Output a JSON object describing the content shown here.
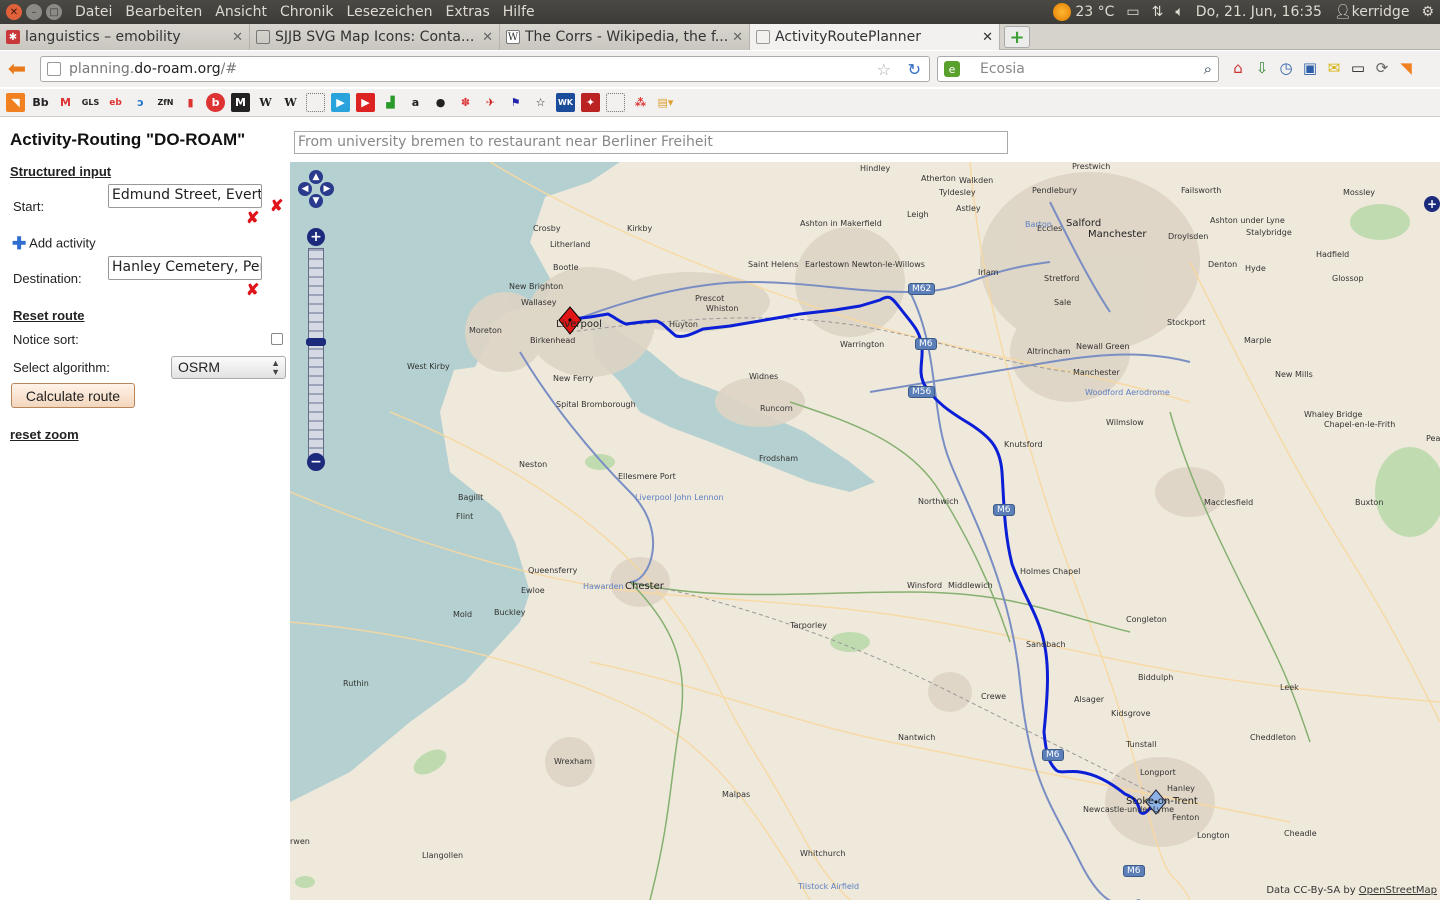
{
  "os": {
    "menu": [
      "Datei",
      "Bearbeiten",
      "Ansicht",
      "Chronik",
      "Lesezeichen",
      "Extras",
      "Hilfe"
    ],
    "weather": "23 °C",
    "datetime": "Do, 21. Jun, 16:35",
    "user": "kerridge"
  },
  "tabs": [
    {
      "title": "languistics – emobility",
      "icon": "puzzle-icon"
    },
    {
      "title": "SJJB SVG Map Icons: Conta...",
      "icon": "page-icon"
    },
    {
      "title": "The Corrs - Wikipedia, the f...",
      "icon": "wikipedia-icon"
    },
    {
      "title": "ActivityRoutePlanner",
      "icon": "page-icon"
    }
  ],
  "nav": {
    "url_prefix": "planning.",
    "url_domain": "do-roam.org",
    "url_suffix": "/#",
    "search_placeholder": "Ecosia"
  },
  "bookmarks": [
    "rss",
    "Bb",
    "gmail",
    "GLS",
    "ebay",
    "spiral",
    "ZfN",
    "bahn",
    "b",
    "M",
    "W",
    "W",
    "blank",
    "play",
    "youtube",
    "stats",
    "amazon",
    "rec",
    "paw",
    "plane",
    "flag",
    "star",
    "WK",
    "puma",
    "blank2",
    "dots",
    "folder"
  ],
  "sidebar": {
    "title": "Activity-Routing \"DO-ROAM\"",
    "structured_input": "Structured input",
    "start_label": "Start:",
    "start_value": "Edmund Street, Everton",
    "add_activity": "Add activity",
    "destination_label": "Destination:",
    "destination_value": "Hanley Cemetery, Penkhull",
    "reset_route": "Reset route",
    "notice_sort": "Notice sort:",
    "select_algorithm": "Select algorithm:",
    "algorithm": "OSRM",
    "calculate": "Calculate route",
    "reset_zoom": "reset zoom"
  },
  "query_placeholder": "From university bremen to restaurant near Berliner Freiheit",
  "map": {
    "attribution_prefix": "Data CC-By-SA by ",
    "attribution_link": "OpenStreetMap",
    "route_color": "#0b1fd6",
    "places": [
      {
        "n": "Hindley",
        "c": ""
      },
      {
        "n": "Atherton",
        "c": ""
      },
      {
        "n": "Walkden",
        "c": ""
      },
      {
        "n": "Prestwich",
        "c": ""
      },
      {
        "n": "Pendlebury",
        "c": ""
      },
      {
        "n": "Failsworth",
        "c": ""
      },
      {
        "n": "Mossley",
        "c": ""
      },
      {
        "n": "Tyldesley",
        "c": ""
      },
      {
        "n": "Astley",
        "c": ""
      },
      {
        "n": "Leigh",
        "c": ""
      },
      {
        "n": "Salford",
        "c": "mid"
      },
      {
        "n": "Manchester",
        "c": "mid"
      },
      {
        "n": "Eccles",
        "c": ""
      },
      {
        "n": "Ashton under Lyne",
        "c": ""
      },
      {
        "n": "Stalybridge",
        "c": ""
      },
      {
        "n": "Droylsden",
        "c": ""
      },
      {
        "n": "Crosby",
        "c": ""
      },
      {
        "n": "Kirkby",
        "c": ""
      },
      {
        "n": "Ashton in Makerfield",
        "c": ""
      },
      {
        "n": "Litherland",
        "c": ""
      },
      {
        "n": "Bootle",
        "c": ""
      },
      {
        "n": "Saint Helens",
        "c": ""
      },
      {
        "n": "Earlestown Newton-le-Willows",
        "c": ""
      },
      {
        "n": "Irlam",
        "c": ""
      },
      {
        "n": "Stretford",
        "c": ""
      },
      {
        "n": "Denton",
        "c": ""
      },
      {
        "n": "Hyde",
        "c": ""
      },
      {
        "n": "Hadfield",
        "c": ""
      },
      {
        "n": "Glossop",
        "c": ""
      },
      {
        "n": "New Brighton",
        "c": ""
      },
      {
        "n": "Wallasey",
        "c": ""
      },
      {
        "n": "Prescot",
        "c": ""
      },
      {
        "n": "Whiston",
        "c": ""
      },
      {
        "n": "Sale",
        "c": ""
      },
      {
        "n": "Stockport",
        "c": ""
      },
      {
        "n": "Moreton",
        "c": ""
      },
      {
        "n": "Liverpool",
        "c": "mid"
      },
      {
        "n": "Huyton",
        "c": ""
      },
      {
        "n": "Birkenhead",
        "c": ""
      },
      {
        "n": "Warrington",
        "c": ""
      },
      {
        "n": "Altrincham",
        "c": ""
      },
      {
        "n": "Newall Green",
        "c": ""
      },
      {
        "n": "Marple",
        "c": ""
      },
      {
        "n": "West Kirby",
        "c": ""
      },
      {
        "n": "New Ferry",
        "c": ""
      },
      {
        "n": "Widnes",
        "c": ""
      },
      {
        "n": "New Mills",
        "c": ""
      },
      {
        "n": "Spital Bromborough",
        "c": ""
      },
      {
        "n": "Runcorn",
        "c": ""
      },
      {
        "n": "Wilmslow",
        "c": ""
      },
      {
        "n": "Whaley Bridge",
        "c": ""
      },
      {
        "n": "Chapel-en-le-Frith",
        "c": ""
      },
      {
        "n": "Knutsford",
        "c": ""
      },
      {
        "n": "Frodsham",
        "c": ""
      },
      {
        "n": "Neston",
        "c": ""
      },
      {
        "n": "Ellesmere Port",
        "c": ""
      },
      {
        "n": "Bagillt",
        "c": ""
      },
      {
        "n": "Northwich",
        "c": ""
      },
      {
        "n": "Macclesfield",
        "c": ""
      },
      {
        "n": "Buxton",
        "c": ""
      },
      {
        "n": "Flint",
        "c": ""
      },
      {
        "n": "Queensferry",
        "c": ""
      },
      {
        "n": "Holmes Chapel",
        "c": ""
      },
      {
        "n": "Ewloe",
        "c": ""
      },
      {
        "n": "Chester",
        "c": "mid"
      },
      {
        "n": "Winsford",
        "c": ""
      },
      {
        "n": "Middlewich",
        "c": ""
      },
      {
        "n": "Mold",
        "c": ""
      },
      {
        "n": "Buckley",
        "c": ""
      },
      {
        "n": "Congleton",
        "c": ""
      },
      {
        "n": "Tarporley",
        "c": ""
      },
      {
        "n": "Sandbach",
        "c": ""
      },
      {
        "n": "Biddulph",
        "c": ""
      },
      {
        "n": "Ruthin",
        "c": ""
      },
      {
        "n": "Leek",
        "c": ""
      },
      {
        "n": "Crewe",
        "c": ""
      },
      {
        "n": "Alsager",
        "c": ""
      },
      {
        "n": "Kidsgrove",
        "c": ""
      },
      {
        "n": "Nantwich",
        "c": ""
      },
      {
        "n": "Tunstall",
        "c": ""
      },
      {
        "n": "Cheddleton",
        "c": ""
      },
      {
        "n": "Wrexham",
        "c": ""
      },
      {
        "n": "Longport",
        "c": ""
      },
      {
        "n": "Hanley",
        "c": ""
      },
      {
        "n": "Malpas",
        "c": ""
      },
      {
        "n": "Stoke-on-Trent",
        "c": "mid"
      },
      {
        "n": "Newcastle-under-Lyme",
        "c": ""
      },
      {
        "n": "Fenton",
        "c": ""
      },
      {
        "n": "Longton",
        "c": ""
      },
      {
        "n": "Cheadle",
        "c": ""
      },
      {
        "n": "Llangollen",
        "c": ""
      },
      {
        "n": "Whitchurch",
        "c": ""
      },
      {
        "n": "Liverpool John Lennon",
        "c": ""
      },
      {
        "n": "Woodford Aerodrome",
        "c": ""
      },
      {
        "n": "Barton",
        "c": ""
      },
      {
        "n": "Hawarden",
        "c": ""
      },
      {
        "n": "Tilstock Airfield",
        "c": ""
      },
      {
        "n": "Manchester",
        "c": ""
      },
      {
        "n": "rwen",
        "c": ""
      },
      {
        "n": "Peak District Na",
        "c": ""
      }
    ],
    "shields": [
      "M62",
      "M6",
      "M56",
      "M6",
      "M6",
      "M6"
    ]
  }
}
